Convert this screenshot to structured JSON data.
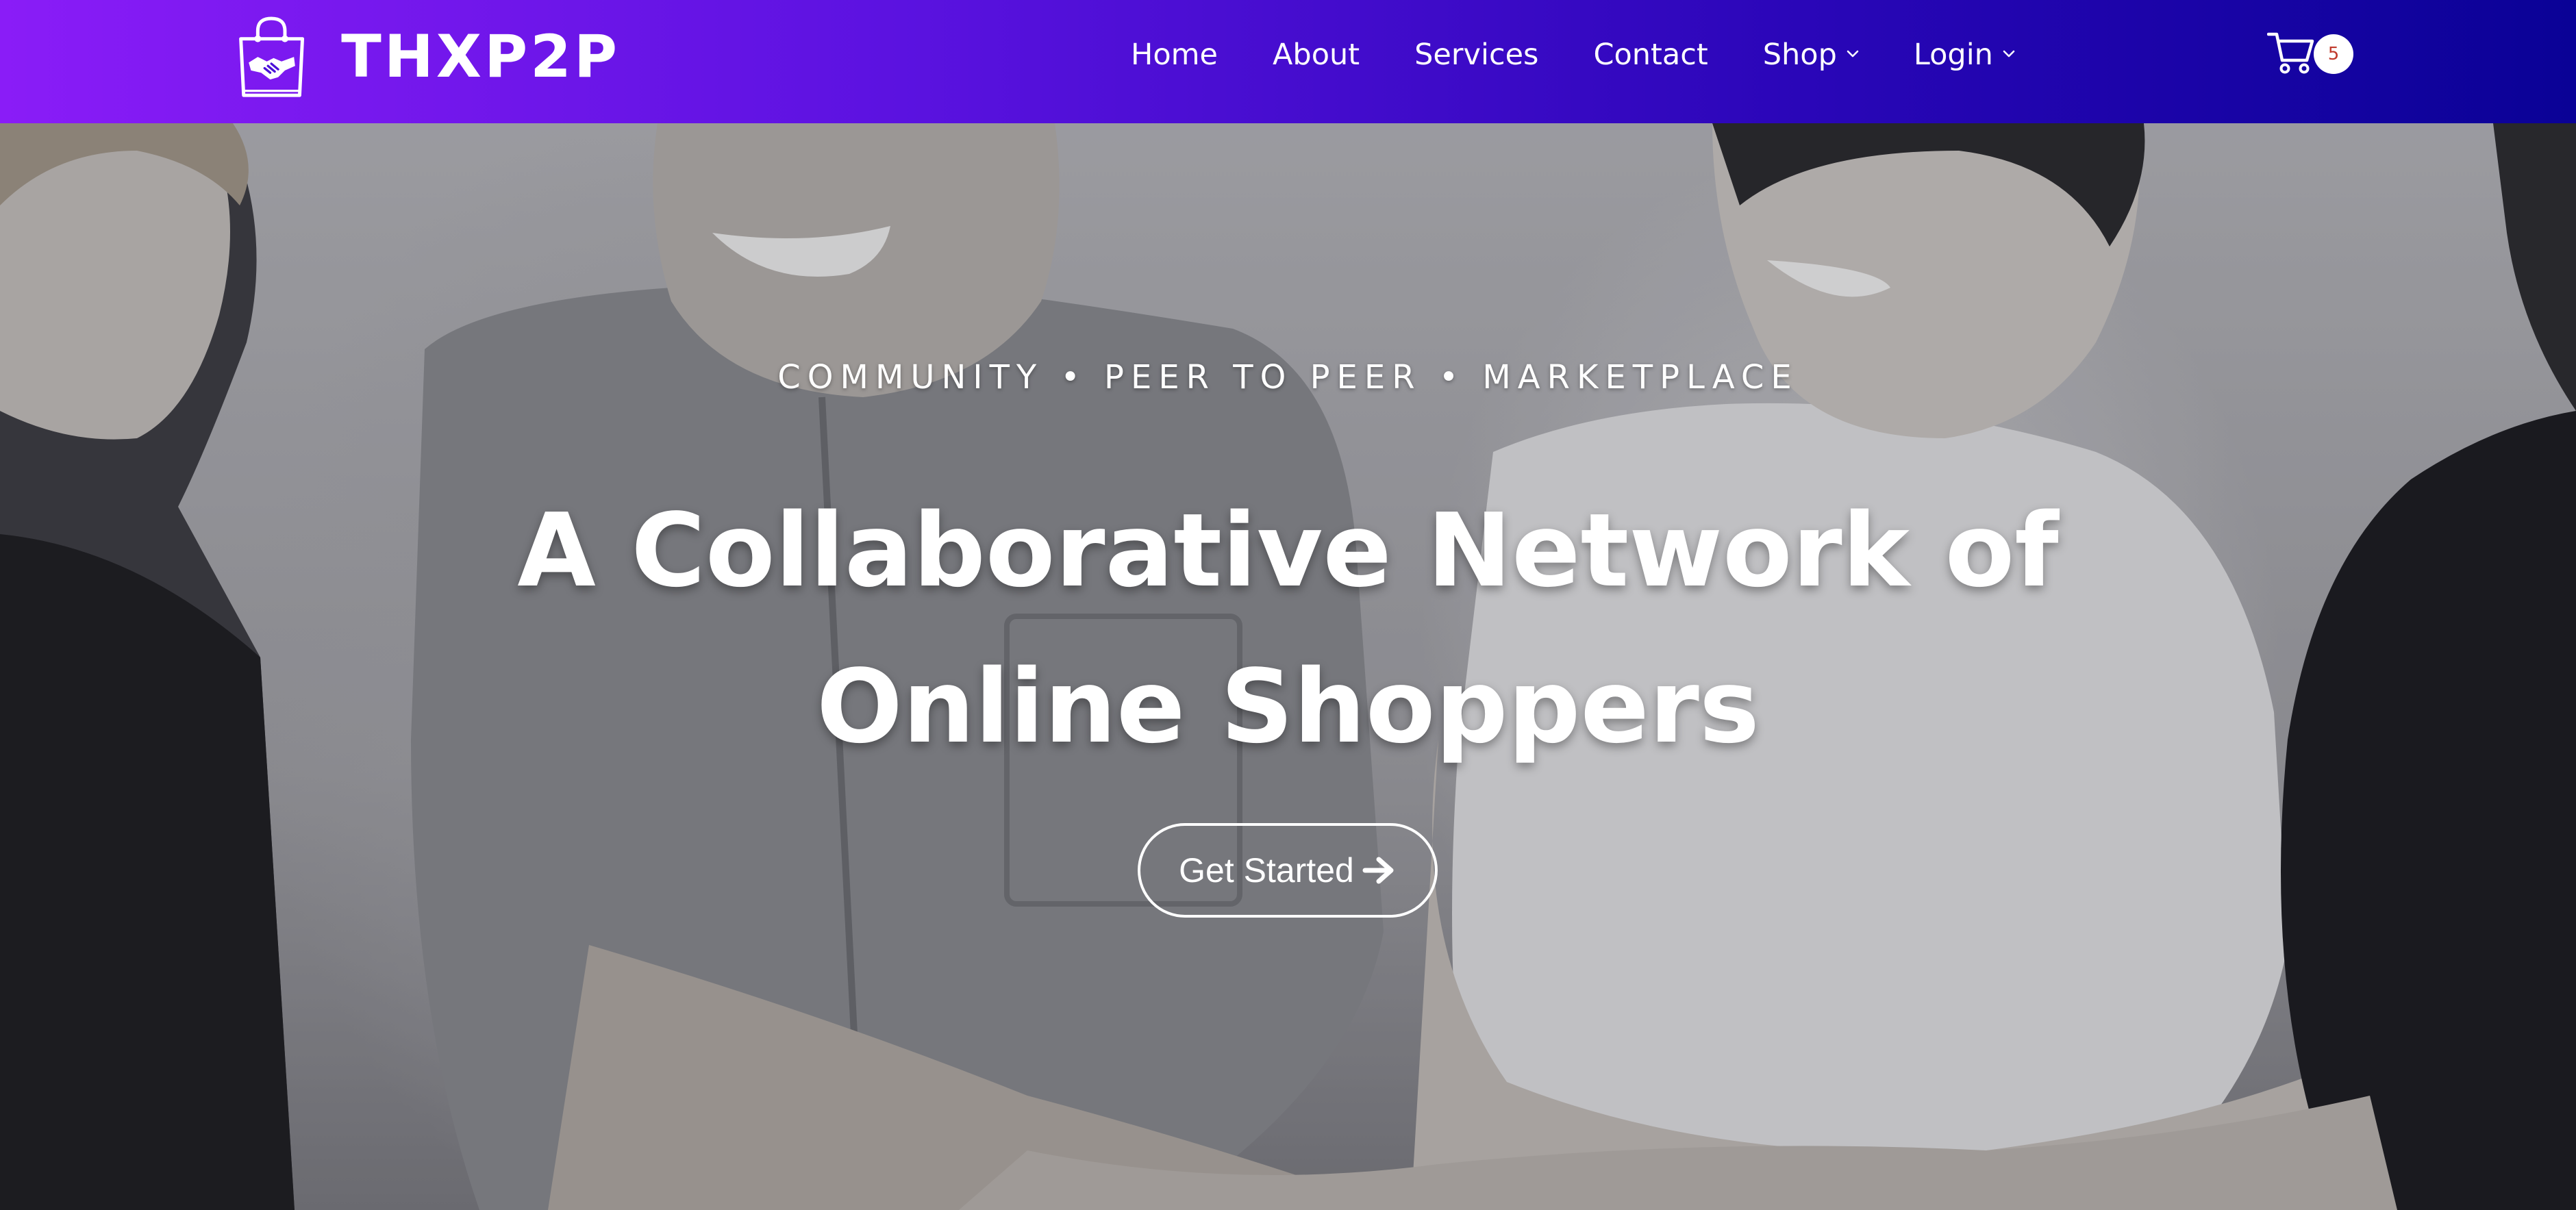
{
  "brand": {
    "name": "THXP2P",
    "logo_icon": "shopping-bag-handshake-icon"
  },
  "nav": {
    "home": "Home",
    "about": "About",
    "services": "Services",
    "contact": "Contact",
    "shop": "Shop",
    "login": "Login",
    "dropdown_icon": "chevron-down-icon"
  },
  "cart": {
    "icon": "shopping-cart-icon",
    "count": "5"
  },
  "hero": {
    "tagline": "COMMUNITY • PEER TO PEER • MARKETPLACE",
    "headline_line1": "A Collaborative Network of",
    "headline_line2": "Online Shoppers",
    "cta_label": "Get Started",
    "cta_icon": "arrow-right-icon",
    "background": "grayscale photo of smiling people joining hands"
  },
  "colors": {
    "header_gradient_start": "#8a1cf7",
    "header_gradient_end": "#0a0296",
    "text": "#ffffff",
    "badge_text": "#c0392b"
  }
}
